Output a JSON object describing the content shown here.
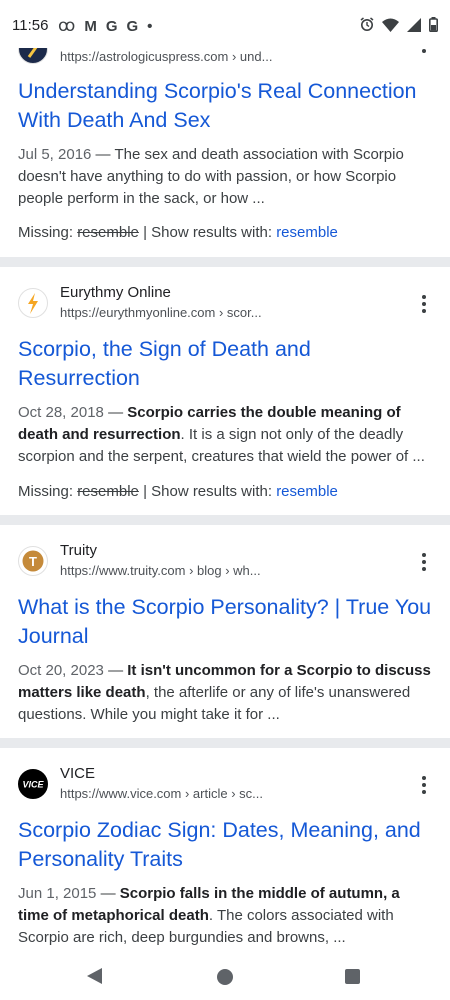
{
  "status_bar": {
    "time": "11:56",
    "left_icons": [
      "voicemail-icon",
      "gmail-icon",
      "google-icon",
      "google-icon",
      "dot-icon"
    ],
    "left_glyphs": [
      "ꝏ",
      "M",
      "G",
      "G",
      "•"
    ],
    "right_icons": [
      "alarm-icon",
      "wifi-icon",
      "signal-icon",
      "battery-icon"
    ]
  },
  "results": [
    {
      "site_name": "",
      "url": "https://astrologicuspress.com",
      "crumb": " › und...",
      "title": "Understanding Scorpio's Real Connection With Death And Sex",
      "date": "Jul 5, 2016",
      "snippet_plain": "The sex and death association with Scorpio doesn't have anything to do with passion, or how Scorpio people perform in the sack, or how ...",
      "missing_label": "Missing:",
      "missing_word": "resemble",
      "show_results_label": "| Show results with:",
      "show_results_link": "resemble"
    },
    {
      "site_name": "Eurythmy Online",
      "url": "https://eurythmyonline.com",
      "crumb": " › scor...",
      "title": "Scorpio, the Sign of Death and Resurrection",
      "date": "Oct 28, 2018",
      "snippet_bold": "Scorpio carries the double meaning of death and resurrection",
      "snippet_rest": ". It is a sign not only of the deadly scorpion and the serpent, creatures that wield the power of ...",
      "missing_label": "Missing:",
      "missing_word": "resemble",
      "show_results_label": "| Show results with:",
      "show_results_link": "resemble"
    },
    {
      "site_name": "Truity",
      "url": "https://www.truity.com",
      "crumb": " › blog › wh...",
      "favicon_letter": "T",
      "title": "What is the Scorpio Personality? | True You Journal",
      "date": "Oct 20, 2023",
      "snippet_bold": "It isn't uncommon for a Scorpio to discuss matters like death",
      "snippet_rest": ", the afterlife or any of life's unanswered questions. While you might take it for ..."
    },
    {
      "site_name": "VICE",
      "url": "https://www.vice.com",
      "crumb": " › article › sc...",
      "favicon_text": "VICE",
      "title": "Scorpio Zodiac Sign: Dates, Meaning, and Personality Traits",
      "date": "Jun 1, 2015",
      "snippet_bold": "Scorpio falls in the middle of autumn, a time of metaphorical death",
      "snippet_rest": ". The colors associated with Scorpio are rich, deep burgundies and browns, ..."
    }
  ],
  "date_separator": " — ",
  "colors": {
    "link": "#1558d6",
    "separator": "#e8eaed",
    "truity_brand": "#c58a3a",
    "eurythmy_brand": "#f5a623"
  }
}
